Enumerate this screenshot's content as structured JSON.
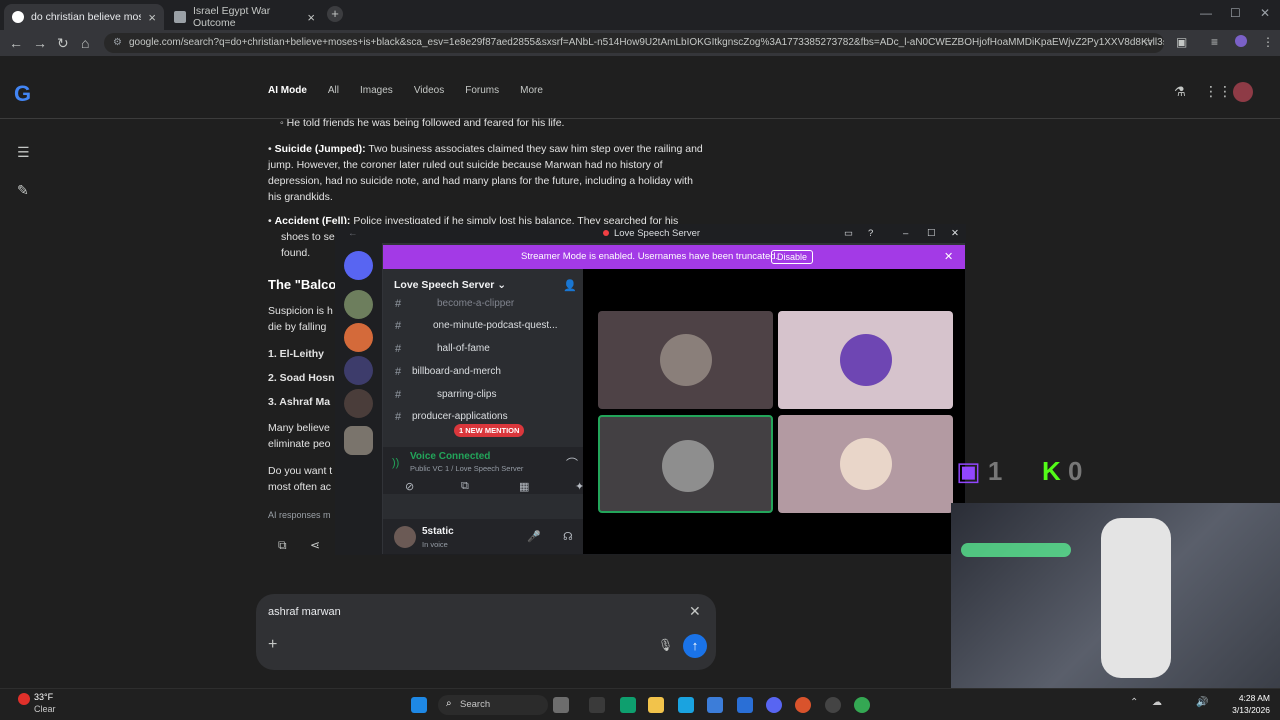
{
  "browser": {
    "tabs": [
      {
        "title": "do christian believe moses is bl"
      },
      {
        "title": "Israel Egypt War Outcome"
      }
    ],
    "url": "google.com/search?q=do+christian+believe+moses+is+black&sca_esv=1e8e29f87aed2855&sxsrf=ANbL-n514How9U2tAmLbIOKGItkgnscZog%3A1773385273782&fbs=ADc_l-aN0CWEZBOHjofHoaMMDiKpaEWjvZ2Py1XXV8d8Kvll3sbM0Xv-8Z..."
  },
  "google": {
    "nav": [
      "AI Mode",
      "All",
      "Images",
      "Videos",
      "Forums",
      "More"
    ],
    "bullet_1": "He told friends he was being followed and feared for his life.",
    "suicide_label": "Suicide (Jumped):",
    "suicide_text": "Two business associates claimed they saw him step over the railing and jump. However, the coroner later ruled out suicide because Marwan had no history of depression, had no suicide note, and had many plans for the future, including a holiday with his grandkids.",
    "accident_label": "Accident (Fell):",
    "accident_text": "Police investigated if he simply lost his balance. They searched for his",
    "accident_text2": "shoes to se",
    "accident_text3": "found.",
    "section_title": "The \"Balco",
    "para1a": "Suspicion is h",
    "para1b": "die by falling",
    "list": [
      "1. El-Leithy",
      "2. Soad Hosn",
      "3. Ashraf Ma"
    ],
    "para2a": "Many believe",
    "para2b": "eliminate peo",
    "para3a": "Do you want t",
    "para3b": "most often ac",
    "disclaimer": "AI responses m",
    "query": "ashraf marwan"
  },
  "discord": {
    "window_title": "Love Speech Server",
    "streamer_notice": "Streamer Mode is enabled. Usernames have been truncated.",
    "disable_label": "Disable",
    "server_name": "Love Speech Server",
    "channels": [
      "become-a-clipper",
      "one-minute-podcast-quest...",
      "hall-of-fame",
      "billboard-and-merch",
      "sparring-clips",
      "producer-applications"
    ],
    "mention_badge": "1 NEW MENTION",
    "voice_status": "Voice Connected",
    "voice_channel": "Public VC 1 / Love Speech Server",
    "username": "5static",
    "user_status": "In voice"
  },
  "overlay": {
    "twitch_count": "1",
    "kick_count": "0"
  },
  "taskbar": {
    "temp": "33°F",
    "weather": "Clear",
    "search": "Search",
    "time": "4:28 AM",
    "date": "3/13/2026"
  }
}
